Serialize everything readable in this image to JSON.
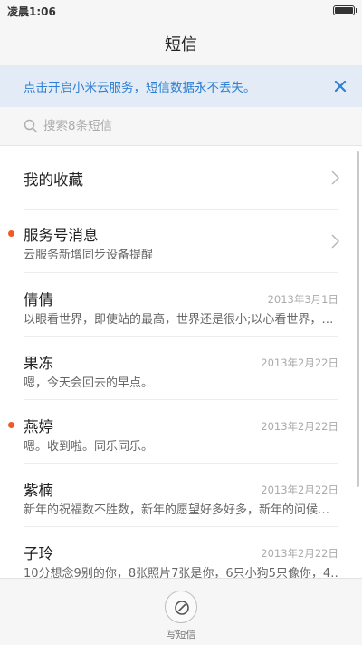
{
  "status_bar": {
    "time": "凌晨1:06"
  },
  "header": {
    "title": "短信"
  },
  "cloud_banner": {
    "text": "点击开启小米云服务，短信数据永不丢失。"
  },
  "search": {
    "placeholder": "搜索8条短信"
  },
  "favorites": {
    "label": "我的收藏"
  },
  "service": {
    "name": "服务号消息",
    "preview": "云服务新增同步设备提醒",
    "unread": true
  },
  "conversations": [
    {
      "name": "倩倩",
      "date": "2013年3月1日",
      "preview": "以眼看世界，即使站的最高，世界还是很小;以心看世界，…",
      "unread": false
    },
    {
      "name": "果冻",
      "date": "2013年2月22日",
      "preview": "嗯，今天会回去的早点。",
      "unread": false
    },
    {
      "name": "燕婷",
      "date": "2013年2月22日",
      "preview": "嗯。收到啦。同乐同乐。",
      "unread": true
    },
    {
      "name": "紫楠",
      "date": "2013年2月22日",
      "preview": "新年的祝福数不胜数，新年的愿望好多好多，新年的问候…",
      "unread": false
    },
    {
      "name": "子玲",
      "date": "2013年2月22日",
      "preview": "10分想念9别的你，8张照片7张是你，6只小狗5只像你，4…",
      "unread": false
    }
  ],
  "bottom": {
    "compose_label": "写短信"
  },
  "colors": {
    "accent_blue": "#2f7fd2",
    "unread_dot": "#f05a24",
    "banner_bg": "#e3ecf6"
  }
}
